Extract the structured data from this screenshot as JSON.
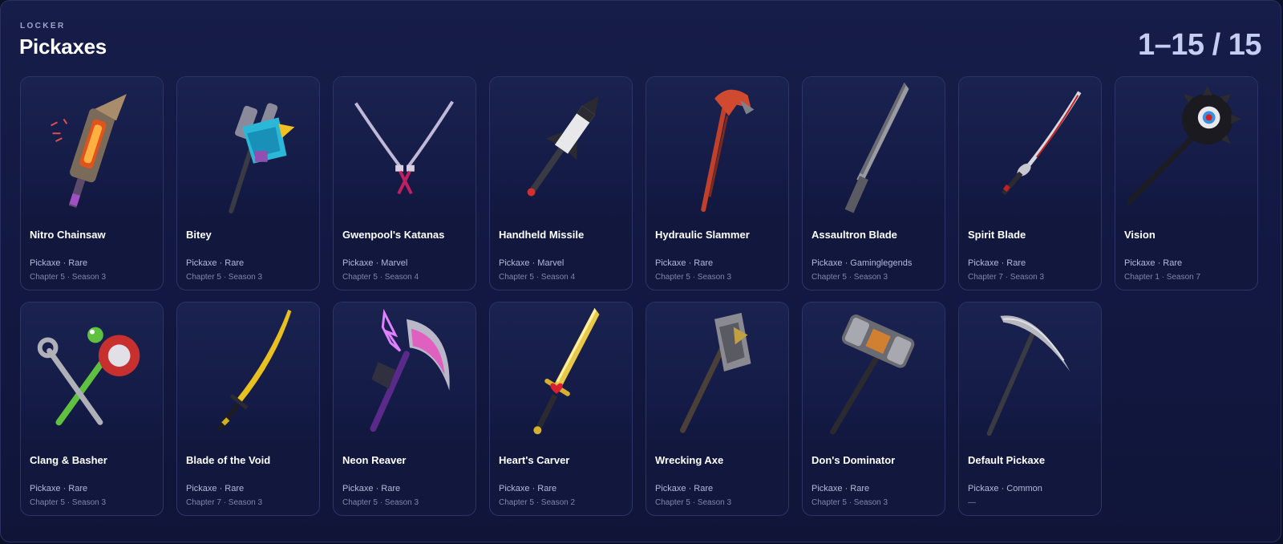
{
  "header": {
    "kicker": "LOCKER",
    "title": "Pickaxes",
    "count": "1–15 / 15"
  },
  "items": [
    {
      "name": "Nitro Chainsaw",
      "meta": "Pickaxe · Rare",
      "season": "Chapter 5 · Season 3",
      "icon": "chainsaw-icon"
    },
    {
      "name": "Bitey",
      "meta": "Pickaxe · Rare",
      "season": "Chapter 5 · Season 3",
      "icon": "drill-hammer-icon"
    },
    {
      "name": "Gwenpool's Katanas",
      "meta": "Pickaxe · Marvel",
      "season": "Chapter 5 · Season 4",
      "icon": "dual-katanas-icon"
    },
    {
      "name": "Handheld Missile",
      "meta": "Pickaxe · Marvel",
      "season": "Chapter 5 · Season 4",
      "icon": "missile-icon"
    },
    {
      "name": "Hydraulic Slammer",
      "meta": "Pickaxe · Rare",
      "season": "Chapter 5 · Season 3",
      "icon": "hydraulic-claw-icon"
    },
    {
      "name": "Assaultron Blade",
      "meta": "Pickaxe · Gaminglegends",
      "season": "Chapter 5 · Season 3",
      "icon": "serrated-blade-icon"
    },
    {
      "name": "Spirit Blade",
      "meta": "Pickaxe · Rare",
      "season": "Chapter 7 · Season 3",
      "icon": "katana-icon"
    },
    {
      "name": "Vision",
      "meta": "Pickaxe · Rare",
      "season": "Chapter 1 · Season 7",
      "icon": "eye-mace-icon"
    },
    {
      "name": "Clang & Basher",
      "meta": "Pickaxe · Rare",
      "season": "Chapter 5 · Season 3",
      "icon": "wrench-hammer-icon"
    },
    {
      "name": "Blade of the Void",
      "meta": "Pickaxe · Rare",
      "season": "Chapter 7 · Season 3",
      "icon": "golden-sword-icon"
    },
    {
      "name": "Neon Reaver",
      "meta": "Pickaxe · Rare",
      "season": "Chapter 5 · Season 3",
      "icon": "neon-scythe-icon"
    },
    {
      "name": "Heart's Carver",
      "meta": "Pickaxe · Rare",
      "season": "Chapter 5 · Season 2",
      "icon": "heart-sword-icon"
    },
    {
      "name": "Wrecking Axe",
      "meta": "Pickaxe · Rare",
      "season": "Chapter 5 · Season 3",
      "icon": "axe-icon"
    },
    {
      "name": "Don's Dominator",
      "meta": "Pickaxe · Rare",
      "season": "Chapter 5 · Season 3",
      "icon": "sledgehammer-icon"
    },
    {
      "name": "Default Pickaxe",
      "meta": "Pickaxe · Common",
      "season": "—",
      "icon": "pickaxe-icon"
    }
  ]
}
